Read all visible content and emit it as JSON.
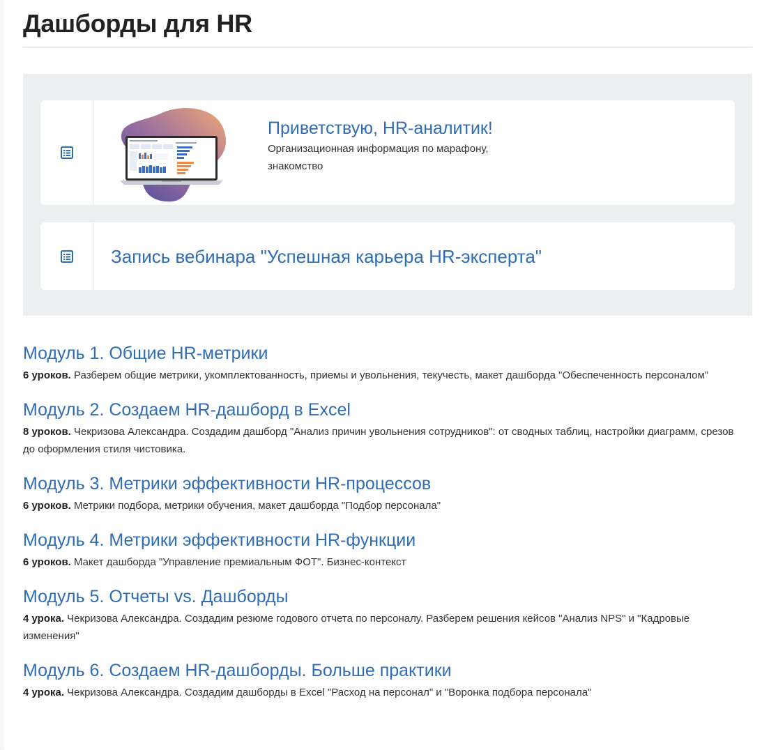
{
  "page": {
    "title": "Дашборды для HR"
  },
  "intro_lessons": [
    {
      "icon": "list-icon",
      "title": "Приветствую, HR-аналитик!",
      "description": "Организационная информация по марафону, знакомство",
      "thumbnail": "laptop-dashboard-image"
    },
    {
      "icon": "list-icon",
      "title": "Запись вебинара \"Успешная карьера HR-эксперта\""
    }
  ],
  "modules": [
    {
      "title": "Модуль 1. Общие HR-метрики",
      "count": "6 уроков.",
      "description": "Разберем общие метрики, укомплектованность, приемы и увольнения, текучесть, макет дашборда \"Обеспеченность персоналом\""
    },
    {
      "title": "Модуль 2. Создаем HR-дашборд в Excel",
      "count": "8 уроков.",
      "description": "Чекризова Александра. Создадим дашборд \"Анализ причин увольнения сотрудников\": от сводных таблиц, настройки диаграмм, срезов до оформления стиля чистовика."
    },
    {
      "title": "Модуль 3. Метрики эффективности HR-процессов",
      "count": "6 уроков.",
      "description": "Метрики подбора, метрики обучения, макет дашборда \"Подбор персонала\""
    },
    {
      "title": "Модуль 4. Метрики эффективности HR-функции",
      "count": "6 уроков.",
      "description": "Макет дашборда \"Управление премиальным ФОТ\". Бизнес-контекст"
    },
    {
      "title": "Модуль 5. Отчеты vs. Дашборды",
      "count": "4 урока.",
      "description": "Чекризова Александра. Создадим резюме годового отчета по персоналу. Разберем решения кейсов \"Анализ NPS\" и \"Кадровые изменения\""
    },
    {
      "title": "Модуль 6. Создаем HR-дашборды. Больше практики",
      "count": "4 урока.",
      "description": "Чекризова Александра. Создадим дашборды в Excel \"Расход на персонал\" и \"Воронка подбора персонала\""
    }
  ],
  "colors": {
    "link": "#2f6db4",
    "text": "#333333",
    "block_bg": "#eceff0",
    "icon": "#2f6db4"
  }
}
